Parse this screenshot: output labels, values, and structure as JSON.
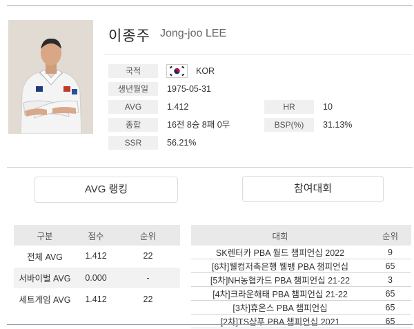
{
  "player": {
    "name_ko": "이종주",
    "name_en": "Jong-joo LEE"
  },
  "profile": {
    "nationality_label": "국적",
    "nationality_value": "KOR",
    "flag_icon": "south-korea-flag-icon",
    "birth_label": "생년월일",
    "birth_value": "1975-05-31",
    "avg_label": "AVG",
    "avg_value": "1.412",
    "hr_label": "HR",
    "hr_value": "10",
    "record_label": "종합",
    "record_value": "16전 8승 8패 0무",
    "bsp_label": "BSP(%)",
    "bsp_value": "31.13%",
    "ssr_label": "SSR",
    "ssr_value": "56.21%"
  },
  "tabs": {
    "avg_ranking": "AVG 랭킹",
    "tournaments": "참여대회"
  },
  "avg_table": {
    "headers": [
      "구분",
      "점수",
      "순위"
    ],
    "rows": [
      [
        "전체 AVG",
        "1.412",
        "22"
      ],
      [
        "서바이벌 AVG",
        "0.000",
        "-"
      ],
      [
        "세트게임 AVG",
        "1.412",
        "22"
      ]
    ]
  },
  "tournament_table": {
    "headers": [
      "대회",
      "순위"
    ],
    "rows": [
      [
        "SK렌터카 PBA 월드 챔피언십 2022",
        "9"
      ],
      [
        "[6차]웰컴저축은행 웰뱅 PBA 챔피언십",
        "65"
      ],
      [
        "[5차]NH농협카드 PBA 챔피언십 21-22",
        "3"
      ],
      [
        "[4차]크라운해태 PBA 챔피언십 21-22",
        "65"
      ],
      [
        "[3차]휴온스 PBA 챔피언십",
        "65"
      ],
      [
        "[2차]TS샴푸 PBA 챔피언십 2021",
        "65"
      ]
    ]
  },
  "colors": {
    "label_bg": "#f0f0f0",
    "header_bg": "#e9e9e9",
    "rule": "#8fa0b3"
  }
}
